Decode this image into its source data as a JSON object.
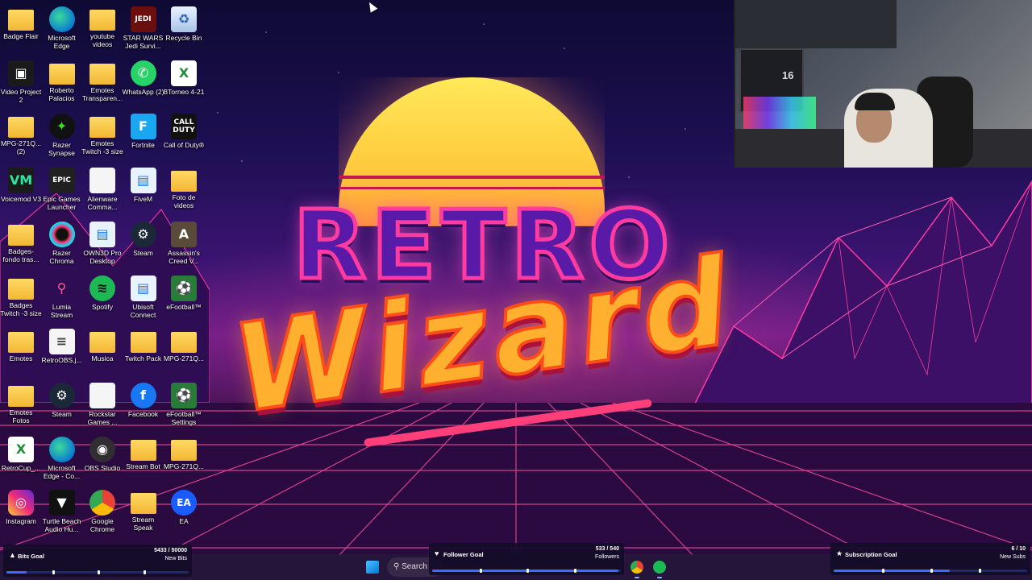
{
  "desktop": {
    "icons": [
      {
        "label": "Badge Flair",
        "glyph": "folder",
        "glyph_text": ""
      },
      {
        "label": "Microsoft Edge",
        "glyph": "edge",
        "glyph_text": ""
      },
      {
        "label": "youtube videos",
        "glyph": "folder",
        "glyph_text": ""
      },
      {
        "label": "STAR WARS Jedi Survi...",
        "glyph": "jedi",
        "glyph_text": "JEDI"
      },
      {
        "label": "Recycle Bin",
        "glyph": "bin",
        "glyph_text": "♻"
      },
      {
        "label": "Video Project 2",
        "glyph": "black",
        "glyph_text": "▣"
      },
      {
        "label": "Roberto Palacios",
        "glyph": "folder",
        "glyph_text": ""
      },
      {
        "label": "Emotes Transparen...",
        "glyph": "folder",
        "glyph_text": ""
      },
      {
        "label": "WhatsApp (2)",
        "glyph": "whatsapp",
        "glyph_text": "✆"
      },
      {
        "label": "BTorneo 4-21",
        "glyph": "excel",
        "glyph_text": "X"
      },
      {
        "label": "MPG-271Q... (2)",
        "glyph": "folder",
        "glyph_text": ""
      },
      {
        "label": "Razer Synapse",
        "glyph": "razer",
        "glyph_text": "✦"
      },
      {
        "label": "Emotes Twitch -3 size",
        "glyph": "folder",
        "glyph_text": ""
      },
      {
        "label": "Fortnite",
        "glyph": "fort",
        "glyph_text": "F"
      },
      {
        "label": "Call of Duty®",
        "glyph": "cod",
        "glyph_text": "CALL DUTY"
      },
      {
        "label": "Voicemod V3",
        "glyph": "voice",
        "glyph_text": "VM"
      },
      {
        "label": "Epic Games Launcher",
        "glyph": "epic",
        "glyph_text": "EPIC"
      },
      {
        "label": "Alienware Comma...",
        "glyph": "doc",
        "glyph_text": ""
      },
      {
        "label": "FiveM",
        "glyph": "blue",
        "glyph_text": "▤"
      },
      {
        "label": "Foto de videos",
        "glyph": "folder",
        "glyph_text": ""
      },
      {
        "label": "Badges-fondo tras...",
        "glyph": "folder",
        "glyph_text": ""
      },
      {
        "label": "Razer Chroma",
        "glyph": "chroma",
        "glyph_text": ""
      },
      {
        "label": "OWN3D Pro Desktop",
        "glyph": "blue",
        "glyph_text": "▤"
      },
      {
        "label": "Steam",
        "glyph": "steam",
        "glyph_text": "⚙"
      },
      {
        "label": "Assassin's Creed V...",
        "glyph": "ac",
        "glyph_text": "A"
      },
      {
        "label": "Badges Twitch -3 size",
        "glyph": "folder",
        "glyph_text": ""
      },
      {
        "label": "Lumia Stream",
        "glyph": "lumia",
        "glyph_text": "⚲"
      },
      {
        "label": "Spotify",
        "glyph": "spotify",
        "glyph_text": "≋"
      },
      {
        "label": "Ubisoft Connect",
        "glyph": "blue",
        "glyph_text": "▤"
      },
      {
        "label": "eFootball™",
        "glyph": "efoot",
        "glyph_text": "⚽"
      },
      {
        "label": "Emotes",
        "glyph": "folder",
        "glyph_text": ""
      },
      {
        "label": "RetroOBS.j...",
        "glyph": "doc",
        "glyph_text": "≡"
      },
      {
        "label": "Musica",
        "glyph": "folder",
        "glyph_text": ""
      },
      {
        "label": "Twitch Pack",
        "glyph": "folder",
        "glyph_text": ""
      },
      {
        "label": "MPG-271Q...",
        "glyph": "folder",
        "glyph_text": ""
      },
      {
        "label": "Emotes Fotos",
        "glyph": "folder",
        "glyph_text": ""
      },
      {
        "label": "Steam",
        "glyph": "steam",
        "glyph_text": "⚙"
      },
      {
        "label": "Rockstar Games ...",
        "glyph": "doc",
        "glyph_text": ""
      },
      {
        "label": "Facebook",
        "glyph": "fb",
        "glyph_text": "f"
      },
      {
        "label": "eFootball™ Settings",
        "glyph": "efoot",
        "glyph_text": "⚽"
      },
      {
        "label": "RetroCup_...",
        "glyph": "excel",
        "glyph_text": "X"
      },
      {
        "label": "Microsoft Edge - Co...",
        "glyph": "edge",
        "glyph_text": ""
      },
      {
        "label": "OBS Studio",
        "glyph": "obs",
        "glyph_text": "◉"
      },
      {
        "label": "Stream Bot",
        "glyph": "folder",
        "glyph_text": ""
      },
      {
        "label": "MPG-271Q...",
        "glyph": "folder",
        "glyph_text": ""
      },
      {
        "label": "Instagram",
        "glyph": "insta",
        "glyph_text": "◎"
      },
      {
        "label": "Turtle Beach Audio Hu...",
        "glyph": "turtle",
        "glyph_text": "▼"
      },
      {
        "label": "Google Chrome",
        "glyph": "chrome",
        "glyph_text": ""
      },
      {
        "label": "Stream Speak",
        "glyph": "folder",
        "glyph_text": ""
      },
      {
        "label": "EA",
        "glyph": "ea",
        "glyph_text": "EA"
      }
    ]
  },
  "wallpaper": {
    "line1": "RETRO",
    "line2": "Wizard"
  },
  "webcam": {
    "jersey_number": "16"
  },
  "taskbar": {
    "search_label": "Search",
    "pinned": [
      "chrome-icon",
      "spotify-icon"
    ]
  },
  "goals": {
    "bits": {
      "title": "Bits Goal",
      "count": "5433 / 50000",
      "unit": "New Bits",
      "progress": 0.109
    },
    "followers": {
      "title": "Follower Goal",
      "count": "533 / 540",
      "unit": "Followers",
      "progress": 0.987
    },
    "subs": {
      "title": "Subscription Goal",
      "count": "6 / 10",
      "unit": "New Subs",
      "progress": 0.6
    }
  },
  "colors": {
    "accent": "#3c6cff",
    "neon_pink": "#ff3aa0",
    "sun_yellow": "#ffe95a"
  }
}
